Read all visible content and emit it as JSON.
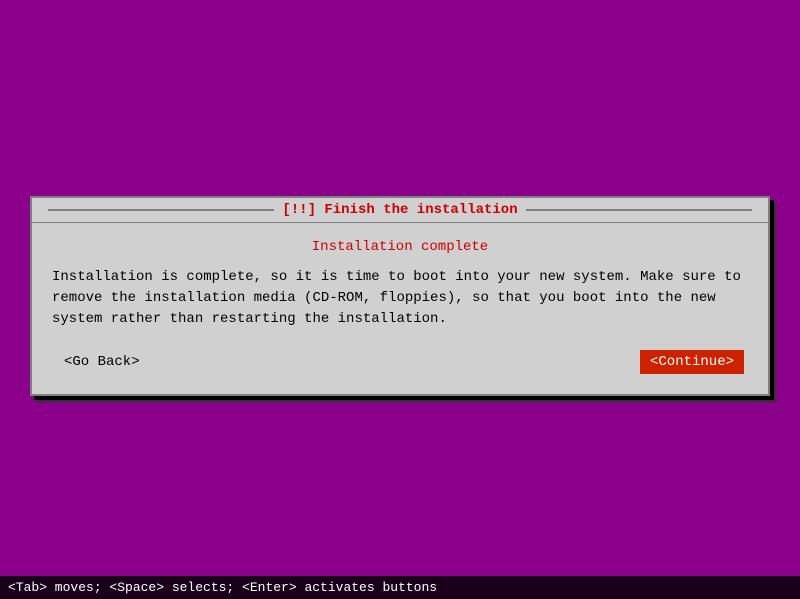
{
  "background": {
    "color": "#8b008b"
  },
  "dialog": {
    "title": "[!!] Finish the installation",
    "status": "Installation complete",
    "message": "Installation is complete, so it is time to boot into your new system. Make sure to remove\nthe installation media (CD-ROM, floppies), so that you boot into the new system rather\nthan restarting the installation.",
    "go_back_label": "<Go Back>",
    "continue_label": "<Continue>"
  },
  "status_bar": {
    "text": "<Tab> moves; <Space> selects; <Enter> activates buttons"
  }
}
